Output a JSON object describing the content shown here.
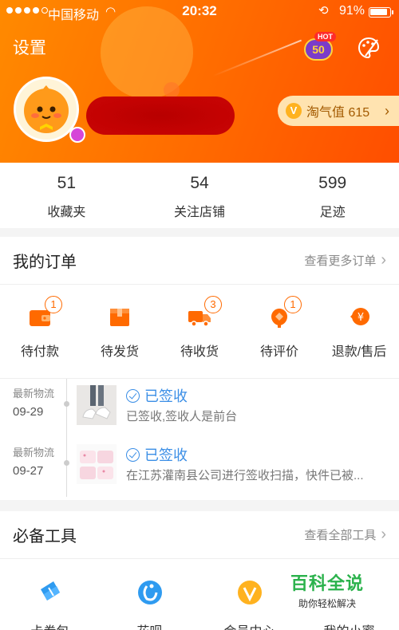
{
  "status_bar": {
    "carrier": "中国移动",
    "time": "20:32",
    "battery": "91%",
    "battery_level": 0.91
  },
  "header": {
    "settings_label": "设置",
    "hot_badge_tag": "HOT",
    "hot_badge_value": "50",
    "taoqi_label": "淘气值 615",
    "taoqi_icon_letter": "V"
  },
  "stats": [
    {
      "num": "51",
      "label": "收藏夹"
    },
    {
      "num": "54",
      "label": "关注店铺"
    },
    {
      "num": "599",
      "label": "足迹"
    }
  ],
  "orders": {
    "title": "我的订单",
    "more": "查看更多订单",
    "items": [
      {
        "label": "待付款",
        "count": "1",
        "icon": "wallet-icon"
      },
      {
        "label": "待发货",
        "count": "",
        "icon": "package-icon"
      },
      {
        "label": "待收货",
        "count": "3",
        "icon": "truck-icon"
      },
      {
        "label": "待评价",
        "count": "1",
        "icon": "review-icon"
      },
      {
        "label": "退款/售后",
        "count": "",
        "icon": "refund-icon"
      }
    ],
    "logistics": [
      {
        "meta": "最新物流",
        "date": "09-29",
        "status": "已签收",
        "desc": "已签收,签收人是前台"
      },
      {
        "meta": "最新物流",
        "date": "09-27",
        "status": "已签收",
        "desc": "在江苏灌南县公司进行签收扫描，快件已被..."
      }
    ]
  },
  "tools": {
    "title": "必备工具",
    "more": "查看全部工具",
    "items": [
      {
        "label": "卡券包",
        "icon": "coupon-icon"
      },
      {
        "label": "花呗",
        "icon": "huabei-icon"
      },
      {
        "label": "会员中心",
        "icon": "vip-icon"
      },
      {
        "label": "我的小蜜",
        "icon": "assistant-icon"
      }
    ]
  },
  "watermark": {
    "title": "百科全说",
    "subtitle": "助你轻松解决"
  },
  "colors": {
    "brand_orange": "#ff6a00",
    "link_blue": "#3a8ee6"
  }
}
